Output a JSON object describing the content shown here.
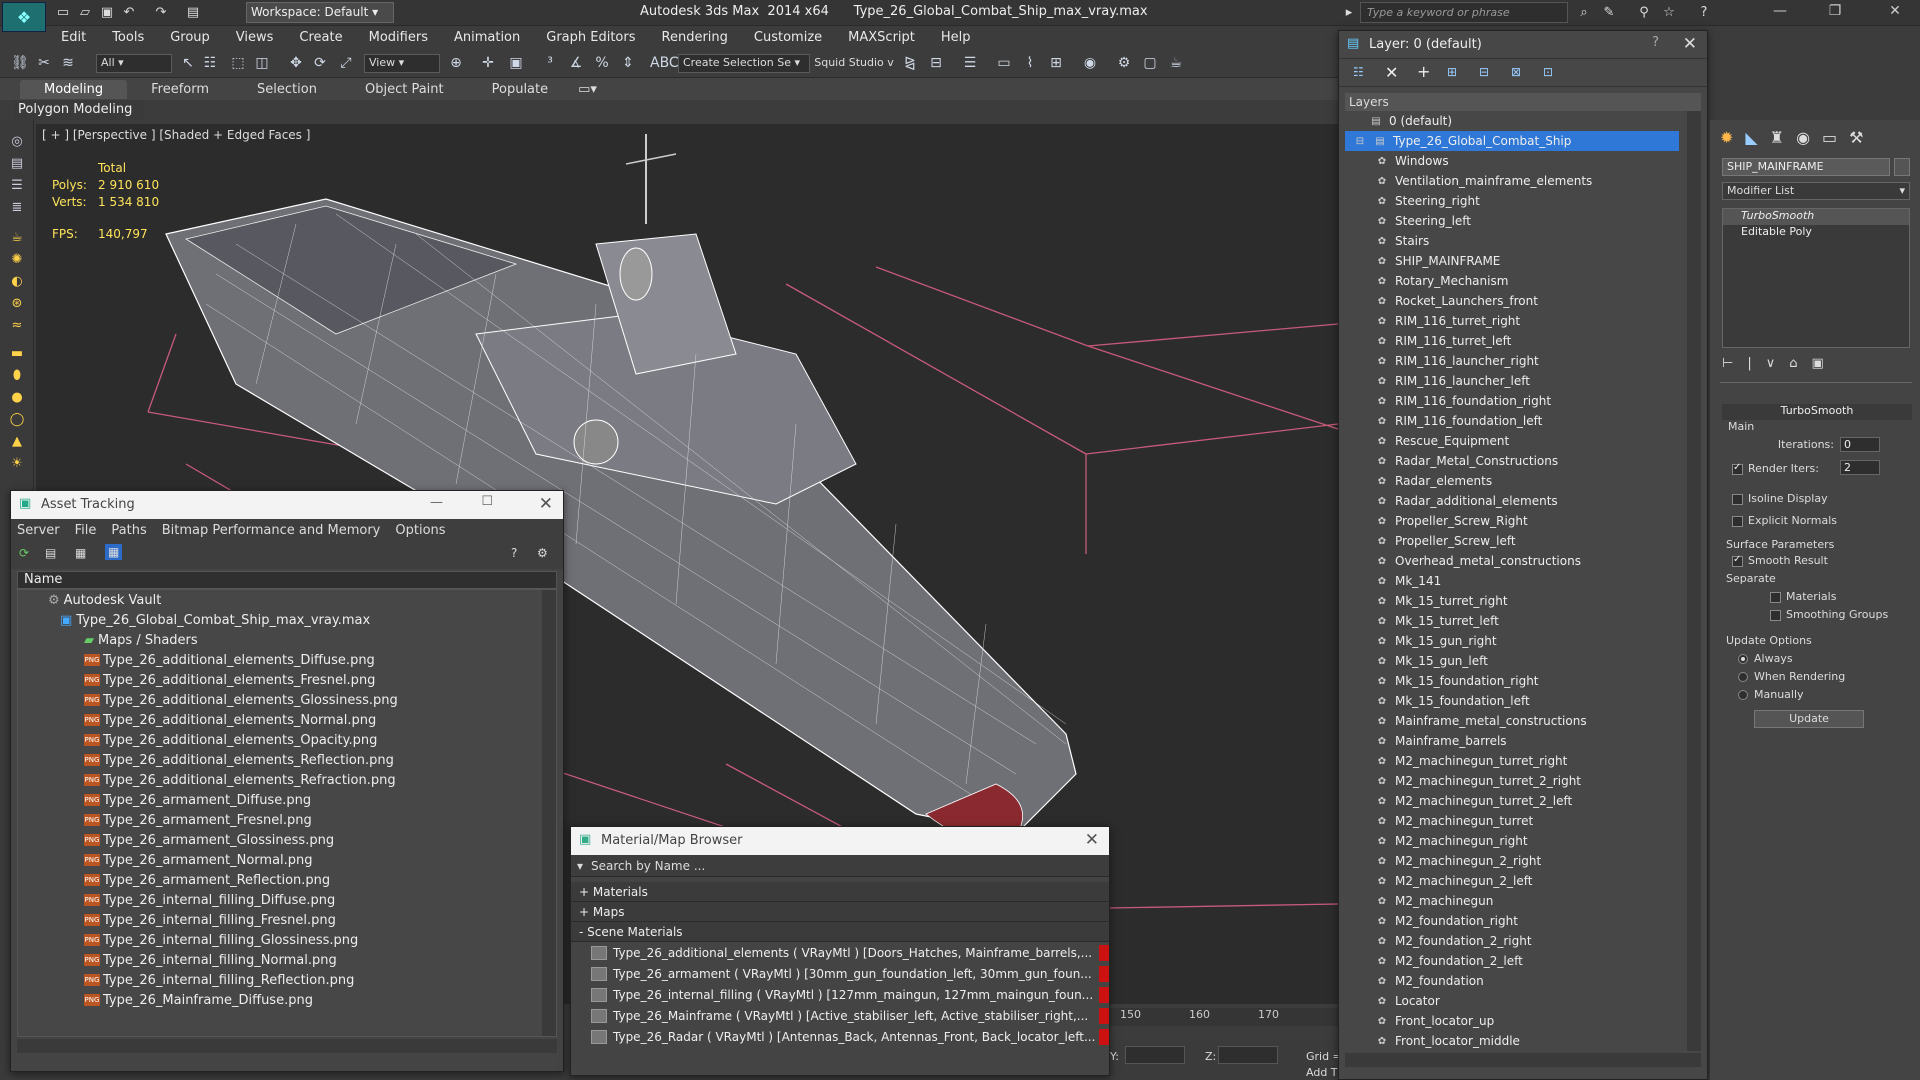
{
  "window": {
    "title": "Autodesk 3ds Max  2014 x64      Type_26_Global_Combat_Ship_max_vray.max",
    "workspace_label": "Workspace: Default",
    "search_placeholder": "Type a keyword or phrase"
  },
  "menu": [
    "Edit",
    "Tools",
    "Group",
    "Views",
    "Create",
    "Modifiers",
    "Animation",
    "Graph Editors",
    "Rendering",
    "Customize",
    "MAXScript",
    "Help"
  ],
  "toolbar": {
    "filter_select": "All",
    "view_select": "View",
    "selection_set": "Create Selection Se",
    "squid_label": "Squid Studio v"
  },
  "ribbon": {
    "tabs": [
      "Modeling",
      "Freeform",
      "Selection",
      "Object Paint",
      "Populate"
    ],
    "sub_label": "Polygon Modeling"
  },
  "viewport": {
    "label": "[ + ] [Perspective ] [Shaded + Edged Faces ]",
    "stats": {
      "total_label": "Total",
      "polys_label": "Polys:",
      "polys_value": "2 910 610",
      "verts_label": "Verts:",
      "verts_value": "1 534 810",
      "fps_label": "FPS:",
      "fps_value": "140,797"
    },
    "timeline_ticks": [
      "150",
      "160",
      "170"
    ]
  },
  "asset_tracking": {
    "title": "Asset Tracking",
    "menu": [
      "Server",
      "File",
      "Paths",
      "Bitmap Performance and Memory",
      "Options"
    ],
    "column_header": "Name",
    "root": "Autodesk Vault",
    "file": "Type_26_Global_Combat_Ship_max_vray.max",
    "folder": "Maps / Shaders",
    "items": [
      "Type_26_additional_elements_Diffuse.png",
      "Type_26_additional_elements_Fresnel.png",
      "Type_26_additional_elements_Glossiness.png",
      "Type_26_additional_elements_Normal.png",
      "Type_26_additional_elements_Opacity.png",
      "Type_26_additional_elements_Reflection.png",
      "Type_26_additional_elements_Refraction.png",
      "Type_26_armament_Diffuse.png",
      "Type_26_armament_Fresnel.png",
      "Type_26_armament_Glossiness.png",
      "Type_26_armament_Normal.png",
      "Type_26_armament_Reflection.png",
      "Type_26_internal_filling_Diffuse.png",
      "Type_26_internal_filling_Fresnel.png",
      "Type_26_internal_filling_Glossiness.png",
      "Type_26_internal_filling_Normal.png",
      "Type_26_internal_filling_Reflection.png",
      "Type_26_Mainframe_Diffuse.png"
    ]
  },
  "material_browser": {
    "title": "Material/Map Browser",
    "search_placeholder": "Search by Name ...",
    "sections": [
      "+ Materials",
      "+ Maps",
      "- Scene Materials"
    ],
    "materials": [
      "Type_26_additional_elements ( VRayMtl ) [Doors_Hatches, Mainframe_barrels,...",
      "Type_26_armament  ( VRayMtl )  [30mm_gun_foundation_left, 30mm_gun_foun...",
      "Type_26_internal_filling  ( VRayMtl )  [127mm_maingun, 127mm_maingun_foun...",
      "Type_26_Mainframe ( VRayMtl ) [Active_stabiliser_left, Active_stabiliser_right,...",
      "Type_26_Radar ( VRayMtl ) [Antennas_Back, Antennas_Front, Back_locator_left..."
    ]
  },
  "layers": {
    "title": "Layer: 0 (default)",
    "header": "Layers",
    "default_layer": "0 (default)",
    "selected_layer": "Type_26_Global_Combat_Ship",
    "items": [
      "Windows",
      "Ventilation_mainframe_elements",
      "Steering_right",
      "Steering_left",
      "Stairs",
      "SHIP_MAINFRAME",
      "Rotary_Mechanism",
      "Rocket_Launchers_front",
      "RIM_116_turret_right",
      "RIM_116_turret_left",
      "RIM_116_launcher_right",
      "RIM_116_launcher_left",
      "RIM_116_foundation_right",
      "RIM_116_foundation_left",
      "Rescue_Equipment",
      "Radar_Metal_Constructions",
      "Radar_elements",
      "Radar_additional_elements",
      "Propeller_Screw_Right",
      "Propeller_Screw_left",
      "Overhead_metal_constructions",
      "Mk_141",
      "Mk_15_turret_right",
      "Mk_15_turret_left",
      "Mk_15_gun_right",
      "Mk_15_gun_left",
      "Mk_15_foundation_right",
      "Mk_15_foundation_left",
      "Mainframe_metal_constructions",
      "Mainframe_barrels",
      "M2_machinegun_turret_right",
      "M2_machinegun_turret_2_right",
      "M2_machinegun_turret_2_left",
      "M2_machinegun_turret",
      "M2_machinegun_right",
      "M2_machinegun_2_right",
      "M2_machinegun_2_left",
      "M2_machinegun",
      "M2_foundation_right",
      "M2_foundation_2_right",
      "M2_foundation_2_left",
      "M2_foundation",
      "Locator",
      "Front_locator_up",
      "Front_locator_middle"
    ]
  },
  "command_panel": {
    "object_name": "SHIP_MAINFRAME",
    "modifier_list": "Modifier List",
    "stack": [
      "TurboSmooth",
      "Editable Poly"
    ],
    "rollout_title": "TurboSmooth",
    "main_label": "Main",
    "iterations_label": "Iterations:",
    "iterations_value": "0",
    "render_iters_label": "Render Iters:",
    "render_iters_value": "2",
    "isoline_label": "Isoline Display",
    "explicit_label": "Explicit Normals",
    "surface_label": "Surface Parameters",
    "smooth_label": "Smooth Result",
    "separate_label": "Separate",
    "materials_label": "Materials",
    "smoothing_label": "Smoothing Groups",
    "update_label": "Update Options",
    "always_label": "Always",
    "when_render_label": "When Rendering",
    "manually_label": "Manually",
    "update_button": "Update"
  },
  "bottom": {
    "y_label": "Y:",
    "z_label": "Z:",
    "grid_label": "Grid =",
    "add_label": "Add T"
  }
}
